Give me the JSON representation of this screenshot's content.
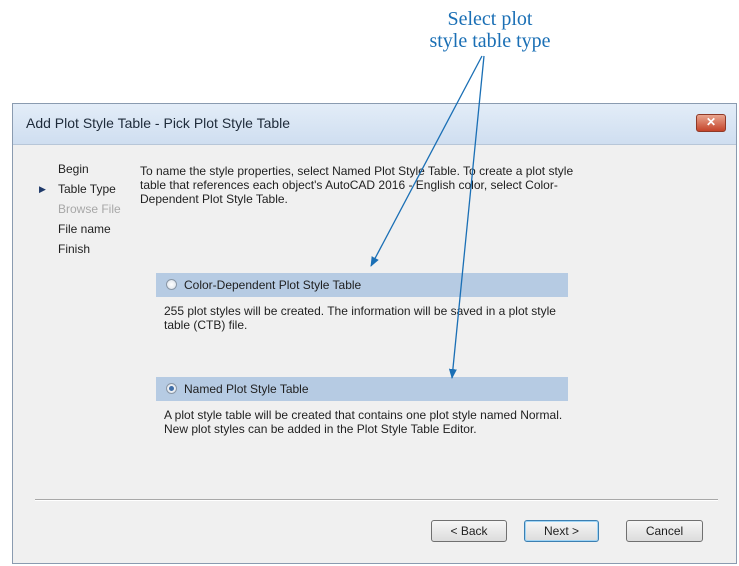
{
  "callout": {
    "line1": "Select plot",
    "line2": "style table type"
  },
  "dialog": {
    "title": "Add Plot Style Table - Pick Plot Style Table",
    "close_label": "✕"
  },
  "steps": [
    {
      "label": "Begin",
      "state": "normal"
    },
    {
      "label": "Table Type",
      "state": "current"
    },
    {
      "label": "Browse File",
      "state": "disabled"
    },
    {
      "label": "File name",
      "state": "normal"
    },
    {
      "label": "Finish",
      "state": "normal"
    }
  ],
  "current_marker": "▶",
  "intro_text": "To name the style properties, select Named Plot Style Table. To create a plot style table that references each object's AutoCAD 2016 - English color, select Color-Dependent Plot Style Table.",
  "options": [
    {
      "label": "Color-Dependent Plot Style Table",
      "selected": false,
      "description": "255 plot styles will be created. The information will be saved in a plot style table (CTB) file."
    },
    {
      "label": "Named Plot Style Table",
      "selected": true,
      "description": "A plot style table will be created that contains one plot style named Normal.  New plot styles can be added in the Plot Style Table Editor."
    }
  ],
  "buttons": {
    "back": "< Back",
    "next": "Next >",
    "cancel": "Cancel"
  },
  "colors": {
    "callout": "#1a6fb5",
    "option_band": "#b6cbe3",
    "close_button": "#c4442a"
  }
}
